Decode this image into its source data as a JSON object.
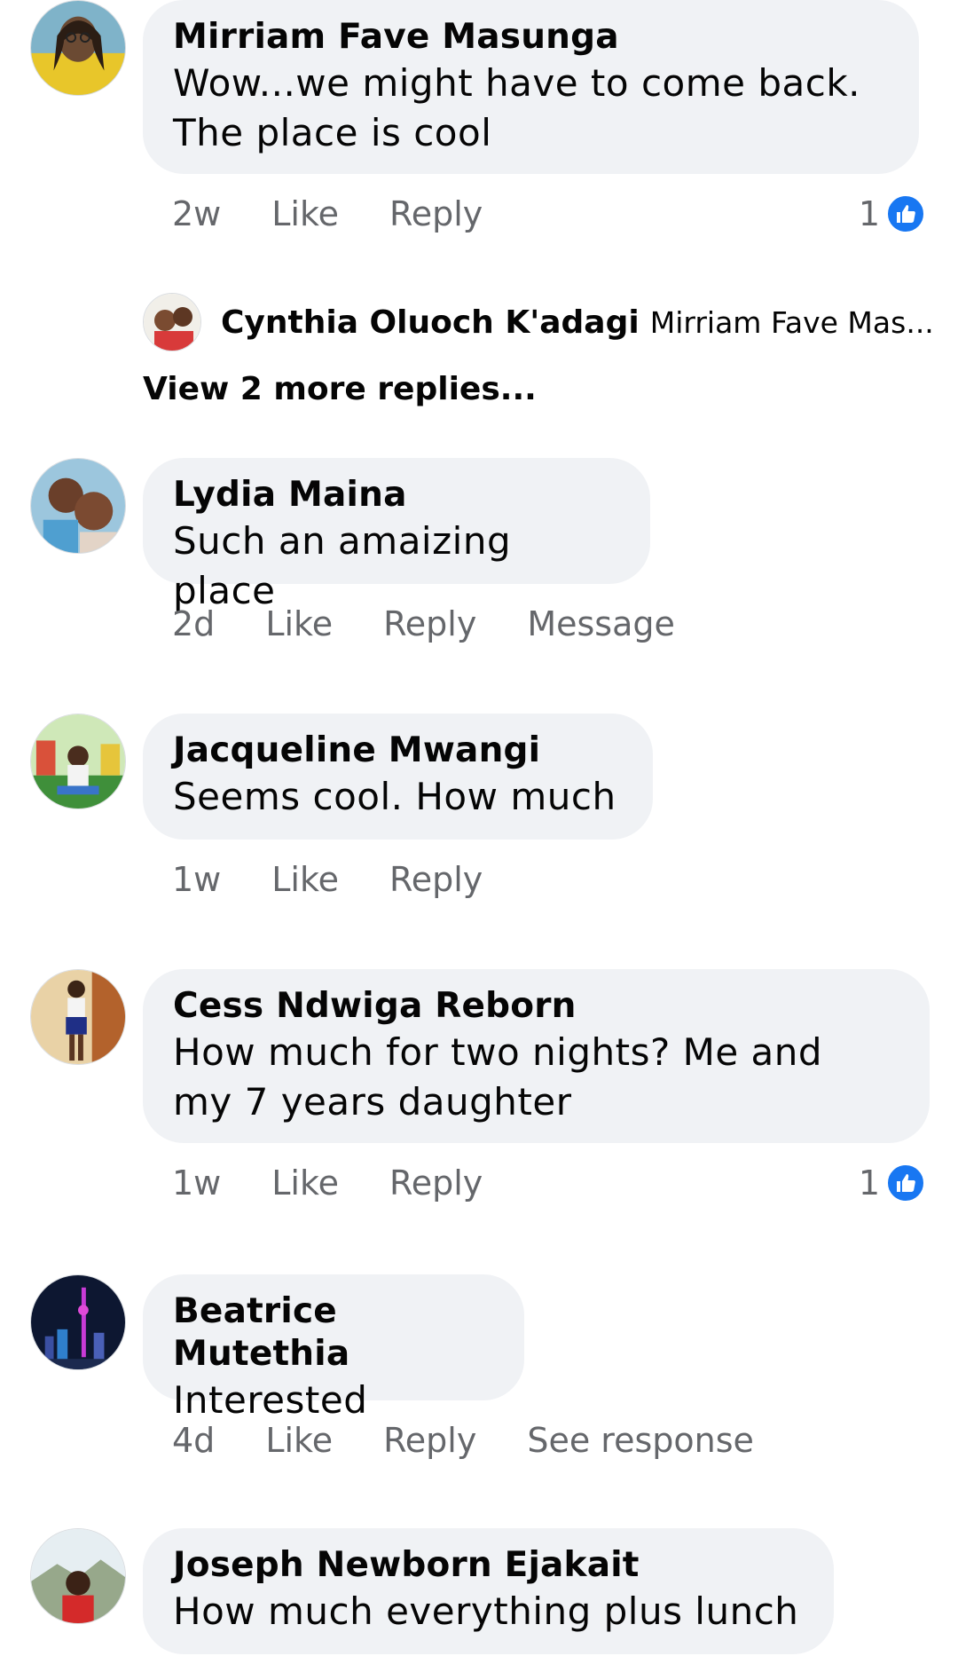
{
  "comments": [
    {
      "name": "Mirriam Fave Masunga",
      "lines": [
        "Wow...we might have to come back.",
        "The place is cool"
      ],
      "time": "2w",
      "actions": [
        "Like",
        "Reply"
      ],
      "reactions": "1",
      "avatar": "avatar-woman-yellow-icon"
    },
    {
      "name": "Lydia Maina",
      "lines": [
        "Such an amaizing place"
      ],
      "time": "2d",
      "actions": [
        "Like",
        "Reply",
        "Message"
      ],
      "avatar": "avatar-two-children-icon"
    },
    {
      "name": "Jacqueline Mwangi",
      "lines": [
        "Seems cool. How much"
      ],
      "time": "1w",
      "actions": [
        "Like",
        "Reply"
      ],
      "avatar": "avatar-playground-icon"
    },
    {
      "name": "Cess Ndwiga Reborn",
      "lines": [
        "How much for two nights? Me and",
        "my 7 years daughter"
      ],
      "time": "1w",
      "actions": [
        "Like",
        "Reply"
      ],
      "reactions": "1",
      "avatar": "avatar-standing-woman-icon"
    },
    {
      "name": "Beatrice Mutethia",
      "lines": [
        "Interested"
      ],
      "time": "4d",
      "actions": [
        "Like",
        "Reply",
        "See response"
      ],
      "avatar": "avatar-city-night-icon"
    },
    {
      "name": "Joseph Newborn Ejakait",
      "lines": [
        "How much everything plus lunch"
      ],
      "avatar": "avatar-man-outdoors-icon"
    }
  ],
  "reply": {
    "name": "Cynthia Oluoch K'adagi",
    "preview": "Mirriam Fave Mas...",
    "more": "View 2 more replies..."
  },
  "colors": {
    "bubble": "#f0f2f5",
    "meta_text": "#65676b",
    "like_blue": "#1877f2"
  }
}
